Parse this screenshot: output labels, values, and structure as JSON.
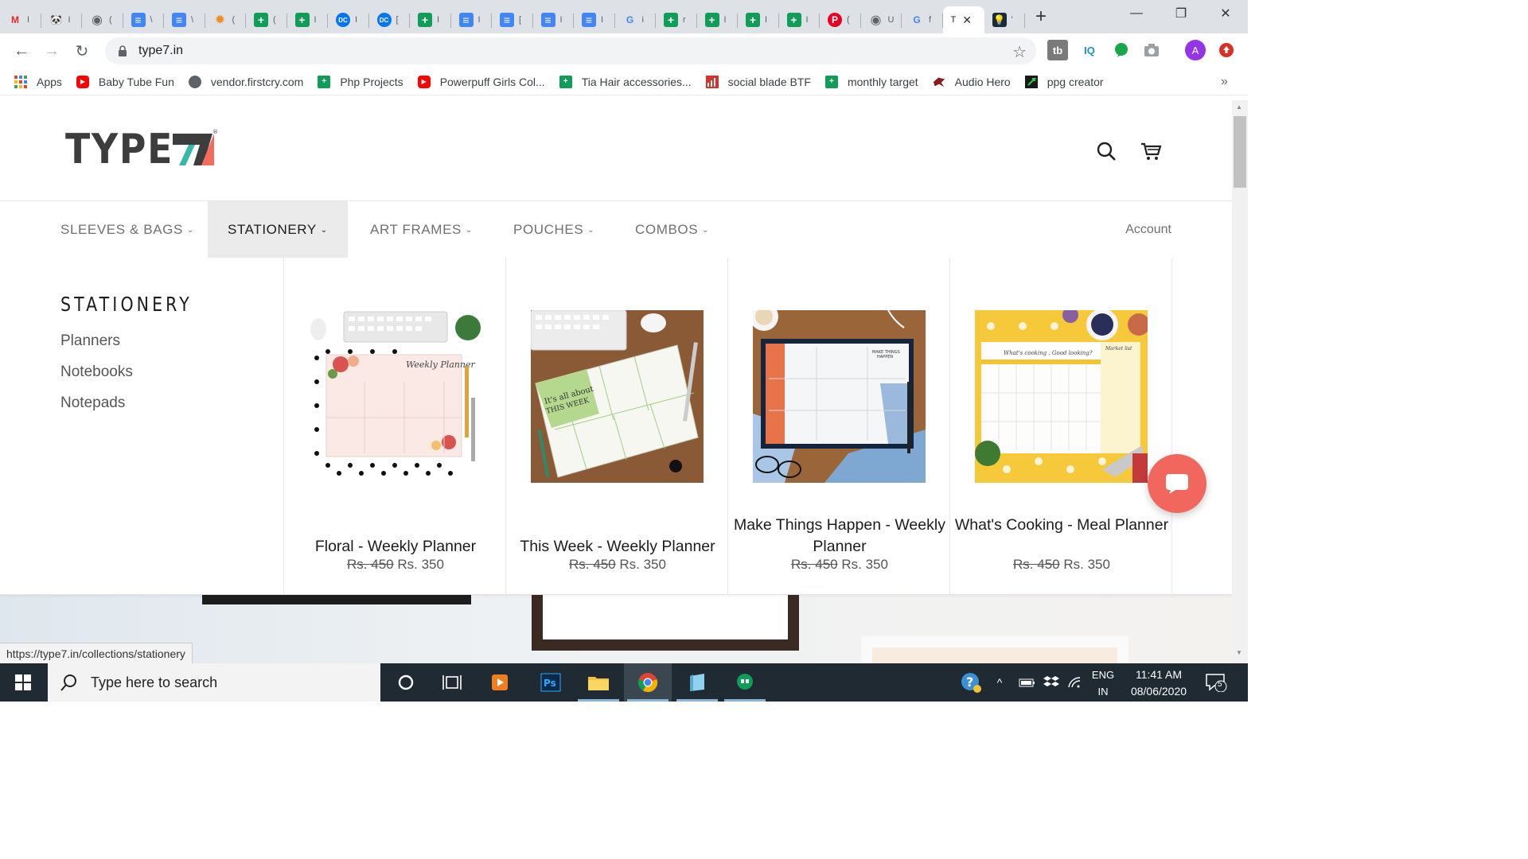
{
  "browser": {
    "tabs": [
      {
        "icon": "gmail-icon",
        "color": "#d93025",
        "glyph": "M",
        "label": "I"
      },
      {
        "icon": "panda-icon",
        "color": "#222222",
        "glyph": "🐼",
        "label": "I"
      },
      {
        "icon": "globe-icon",
        "color": "#5f6368",
        "glyph": "◉",
        "label": "("
      },
      {
        "icon": "google-docs-icon",
        "color": "#4285f4",
        "glyph": "≡",
        "label": "\\"
      },
      {
        "icon": "google-docs-icon",
        "color": "#4285f4",
        "glyph": "≡",
        "label": "\\"
      },
      {
        "icon": "colorful-star-icon",
        "color": "#f08a24",
        "glyph": "✹",
        "label": "("
      },
      {
        "icon": "google-sheets-icon",
        "color": "#0f9d58",
        "glyph": "+",
        "label": "("
      },
      {
        "icon": "google-sheets-icon",
        "color": "#0f9d58",
        "glyph": "+",
        "label": "I"
      },
      {
        "icon": "dc-icon",
        "color": "#0476f2",
        "glyph": "DC",
        "label": "I"
      },
      {
        "icon": "dc-icon",
        "color": "#0476f2",
        "glyph": "DC",
        "label": "["
      },
      {
        "icon": "google-sheets-icon",
        "color": "#0f9d58",
        "glyph": "+",
        "label": "I"
      },
      {
        "icon": "google-docs-icon",
        "color": "#4285f4",
        "glyph": "≡",
        "label": "I"
      },
      {
        "icon": "google-docs-icon",
        "color": "#4285f4",
        "glyph": "≡",
        "label": "["
      },
      {
        "icon": "google-docs-icon",
        "color": "#4285f4",
        "glyph": "≡",
        "label": "I"
      },
      {
        "icon": "google-docs-icon",
        "color": "#4285f4",
        "glyph": "≡",
        "label": "I"
      },
      {
        "icon": "google-icon",
        "color": "#ffffff",
        "glyph": "G",
        "label": "i"
      },
      {
        "icon": "google-sheets-icon",
        "color": "#0f9d58",
        "glyph": "+",
        "label": "r"
      },
      {
        "icon": "google-sheets-icon",
        "color": "#0f9d58",
        "glyph": "+",
        "label": "I"
      },
      {
        "icon": "google-sheets-icon",
        "color": "#0f9d58",
        "glyph": "+",
        "label": "I"
      },
      {
        "icon": "google-sheets-icon",
        "color": "#0f9d58",
        "glyph": "+",
        "label": "I"
      },
      {
        "icon": "pinterest-icon",
        "color": "#e60023",
        "glyph": "P",
        "label": "("
      },
      {
        "icon": "globe-icon",
        "color": "#5f6368",
        "glyph": "◉",
        "label": "U"
      },
      {
        "icon": "google-icon",
        "color": "#ffffff",
        "glyph": "G",
        "label": "f"
      }
    ],
    "active_tab": {
      "label": "T",
      "close": "✕"
    },
    "last_tab": {
      "icon": "lightbulb-icon",
      "label": "'"
    },
    "new_tab": "+",
    "url": "type7.in",
    "bookmarks": [
      {
        "label": "Apps",
        "icon": "apps-grid-icon",
        "color": "#e94235"
      },
      {
        "label": "Baby Tube Fun",
        "icon": "youtube-icon",
        "color": "#ff0000"
      },
      {
        "label": "vendor.firstcry.com",
        "icon": "globe-icon",
        "color": "#5f6368"
      },
      {
        "label": "Php Projects",
        "icon": "google-sheets-icon",
        "color": "#0f9d58"
      },
      {
        "label": "Powerpuff Girls Col...",
        "icon": "youtube-icon",
        "color": "#ff0000"
      },
      {
        "label": "Tia Hair accessories...",
        "icon": "google-sheets-icon",
        "color": "#0f9d58"
      },
      {
        "label": "social blade BTF",
        "icon": "bar-chart-icon",
        "color": "#d9302a"
      },
      {
        "label": "monthly target",
        "icon": "google-sheets-icon",
        "color": "#0f9d58"
      },
      {
        "label": "Audio Hero",
        "icon": "hero-icon",
        "color": "#8b1a1a"
      },
      {
        "label": "ppg creator",
        "icon": "ppg-icon",
        "color": "#1a1a1a"
      }
    ],
    "bookmarks_more": "»",
    "profile_initial": "A",
    "status_url": "https://type7.in/collections/stationery"
  },
  "site": {
    "logo_text": "TYPE",
    "nav": [
      {
        "label": "SLEEVES & BAGS"
      },
      {
        "label": "STATIONERY"
      },
      {
        "label": "ART FRAMES"
      },
      {
        "label": "POUCHES"
      },
      {
        "label": "COMBOS"
      }
    ],
    "account": "Account",
    "mega": {
      "title": "STATIONERY",
      "links": [
        "Planners",
        "Notebooks",
        "Notepads"
      ],
      "products": [
        {
          "name": "Floral - Weekly Planner",
          "old_price": "Rs. 450",
          "price": "Rs. 350"
        },
        {
          "name": "This Week - Weekly Planner",
          "old_price": "Rs. 450",
          "price": "Rs. 350"
        },
        {
          "name": "Make Things Happen - Weekly Planner",
          "old_price": "Rs. 450",
          "price": "Rs. 350"
        },
        {
          "name": "What's Cooking - Meal Planner",
          "old_price": "Rs. 450",
          "price": "Rs. 350"
        }
      ]
    },
    "accent": "#f2675d"
  },
  "taskbar": {
    "search_placeholder": "Type here to search",
    "lang_top": "ENG",
    "lang_bottom": "IN",
    "time": "11:41 AM",
    "date": "08/06/2020",
    "notifications": "5"
  }
}
